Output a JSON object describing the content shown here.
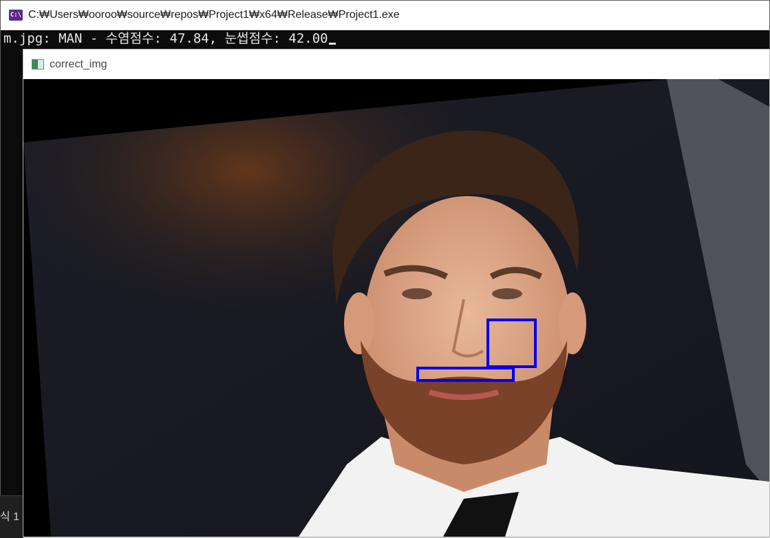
{
  "console": {
    "icon_text": "C:\\",
    "title": "C:₩Users₩ooroo₩source₩repos₩Project1₩x64₩Release₩Project1.exe",
    "output_line": "m.jpg: MAN - 수염점수: 47.84, 눈썹점수: 42.00",
    "bottom_fragment": "식 1"
  },
  "image_window": {
    "title": "correct_img",
    "detection_color": "#0000ee"
  }
}
